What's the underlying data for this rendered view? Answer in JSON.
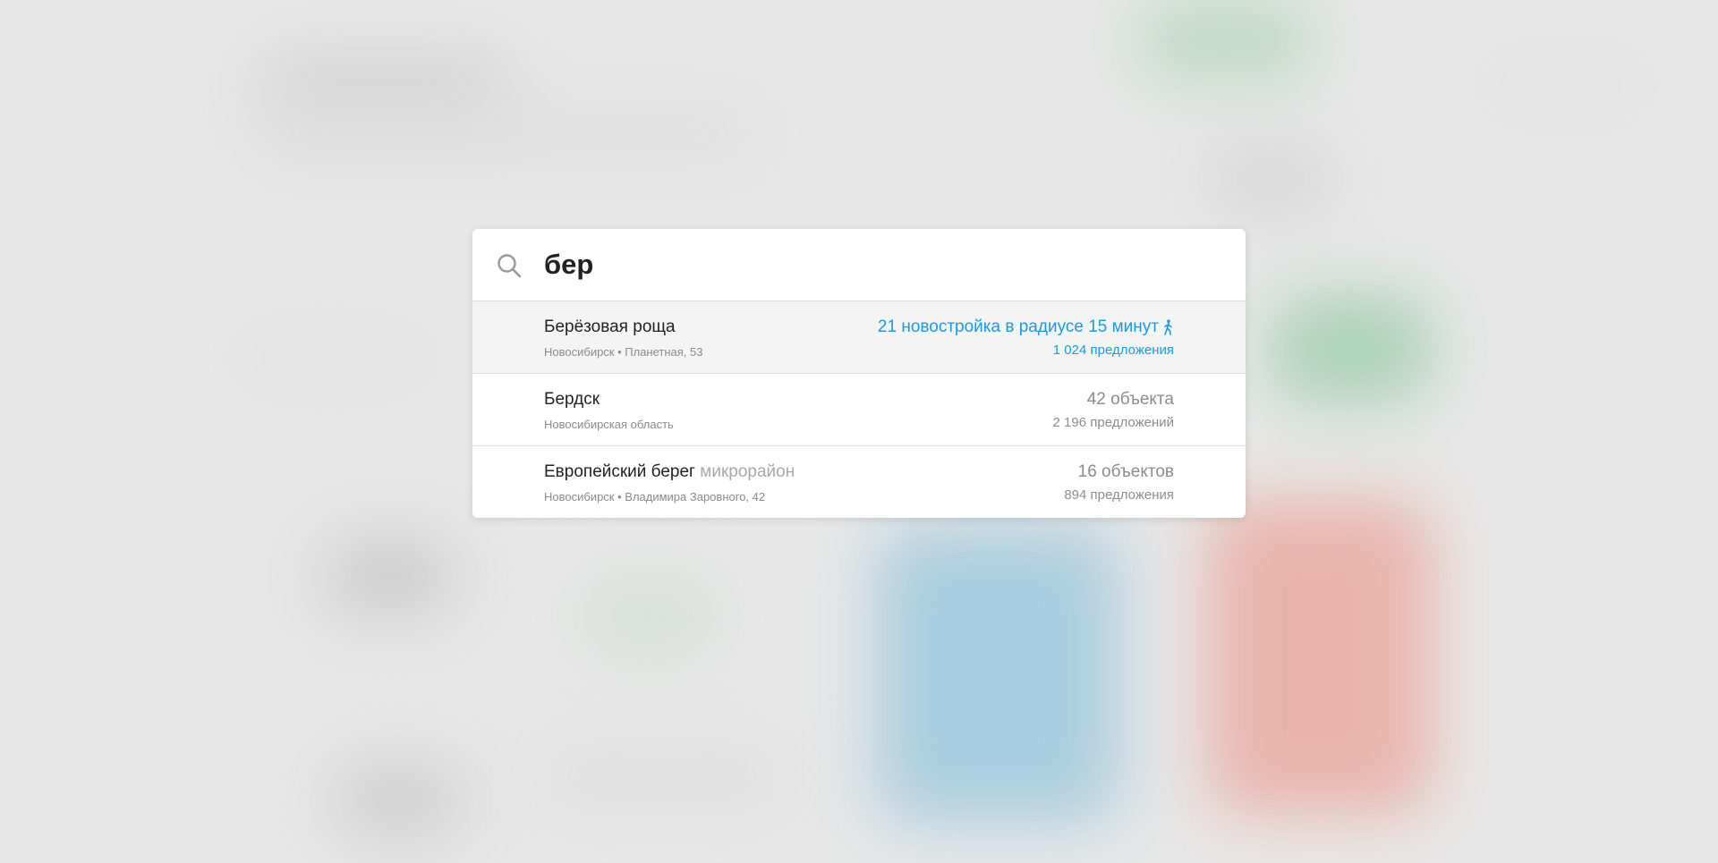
{
  "search": {
    "value": "бер",
    "icon": "search-icon"
  },
  "results": [
    {
      "title": "Берёзовая роща",
      "tag": "",
      "subtitle": "Новосибирск • Планетная, 53",
      "count": "21 новостройка в радиусе 15 минут",
      "offers": "1 024 предложения",
      "count_icon": "walking-person-icon"
    },
    {
      "title": "Бердск",
      "tag": "",
      "subtitle": "Новосибирская область",
      "count": "42 объекта",
      "offers": "2 196 предложений"
    },
    {
      "title": "Европейский берег",
      "tag": "микрорайон",
      "subtitle": "Новосибирск • Владимира Заровного, 42",
      "count": "16 объектов",
      "offers": "894 предложения"
    }
  ],
  "colors": {
    "accent": "#1a9ae0",
    "active_row_bg": "#f4f4f4",
    "text_primary": "#222222",
    "text_secondary": "#8c8c8c"
  }
}
